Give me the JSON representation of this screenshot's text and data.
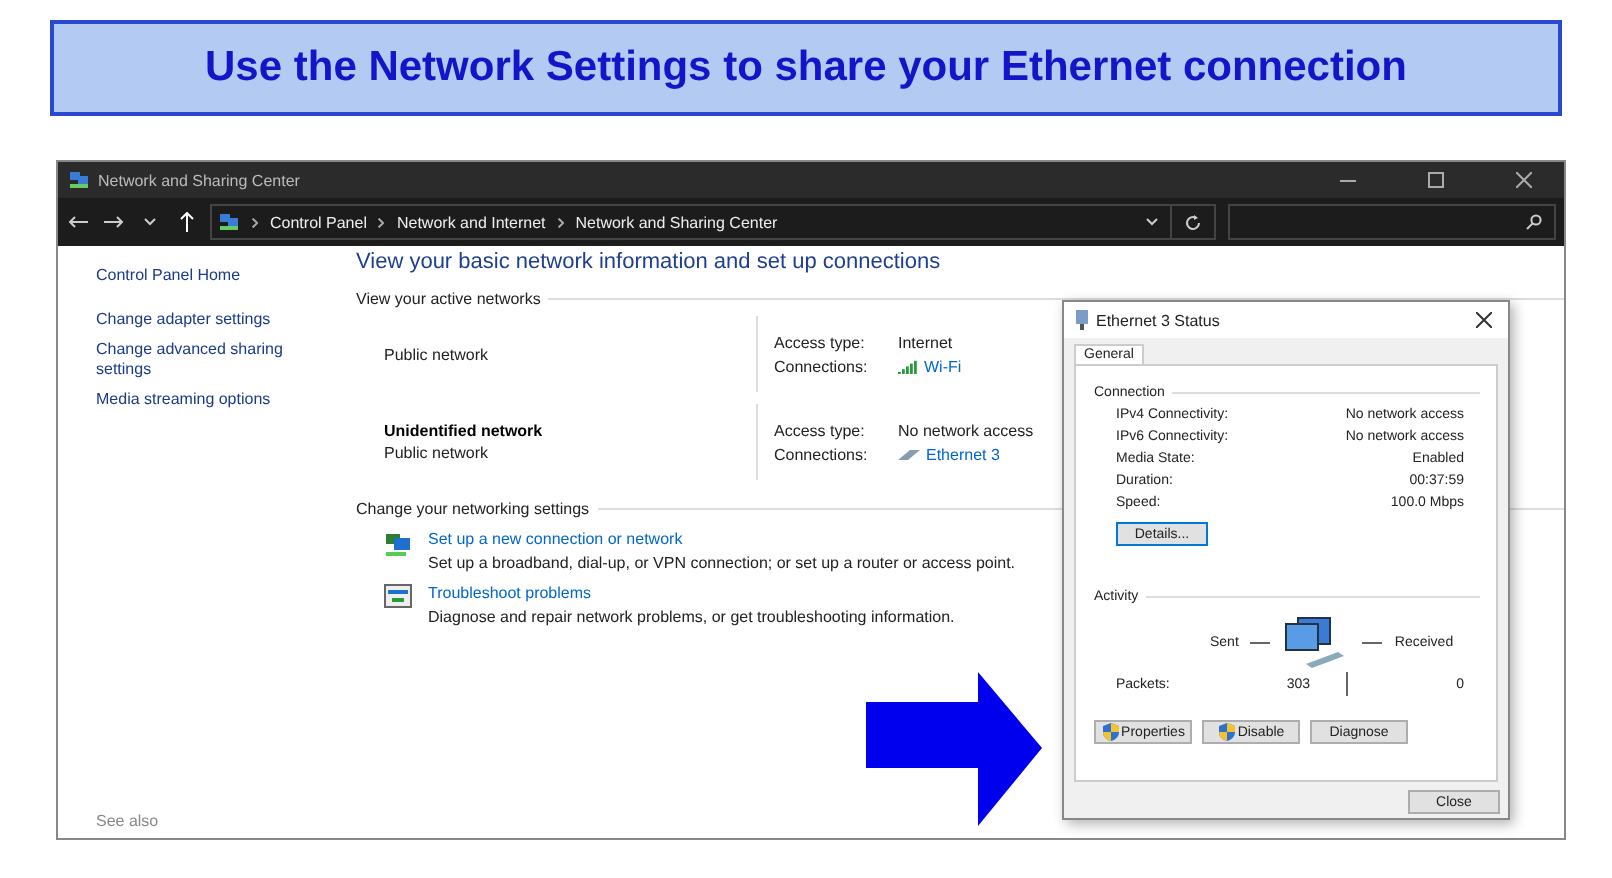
{
  "banner": {
    "title": "Use the Network Settings to share your Ethernet connection"
  },
  "window": {
    "title": "Network and Sharing Center",
    "path": [
      "Control Panel",
      "Network and Internet",
      "Network and Sharing Center"
    ]
  },
  "sidebar": {
    "items": [
      "Control Panel Home",
      "Change adapter settings",
      "Change advanced sharing settings",
      "Media streaming options"
    ],
    "see_also": "See also"
  },
  "main": {
    "heading": "View your basic network information and set up connections",
    "active_label": "View your active networks",
    "networks": [
      {
        "category": "Public network",
        "access_label": "Access type:",
        "access": "Internet",
        "connections_label": "Connections:",
        "connection": "Wi-Fi",
        "kind": "wifi"
      },
      {
        "name": "Unidentified network",
        "category": "Public network",
        "access_label": "Access type:",
        "access": "No network access",
        "connections_label": "Connections:",
        "connection": "Ethernet 3",
        "kind": "ethernet"
      }
    ],
    "settings_label": "Change your networking settings",
    "tasks": [
      {
        "link": "Set up a new connection or network",
        "description": "Set up a broadband, dial-up, or VPN connection; or set up a router or access point.",
        "kind": "setup"
      },
      {
        "link": "Troubleshoot problems",
        "description": "Diagnose and repair network problems, or get troubleshooting information.",
        "kind": "troubleshoot"
      }
    ]
  },
  "dialog": {
    "title": "Ethernet 3 Status",
    "tabs": [
      {
        "label": "General",
        "selected": true
      }
    ],
    "connection_label": "Connection",
    "rows": [
      {
        "label": "IPv4 Connectivity:",
        "value": "No network access"
      },
      {
        "label": "IPv6 Connectivity:",
        "value": "No network access"
      },
      {
        "label": "Media State:",
        "value": "Enabled"
      },
      {
        "label": "Duration:",
        "value": "00:37:59"
      },
      {
        "label": "Speed:",
        "value": "100.0 Mbps"
      }
    ],
    "details_button": "Details...",
    "activity_label": "Activity",
    "sent_label": "Sent",
    "received_label": "Received",
    "packets_label": "Packets:",
    "packets_sent": "303",
    "packets_received": "0",
    "buttons": [
      {
        "label": "Properties",
        "shield": true
      },
      {
        "label": "Disable",
        "shield": true
      },
      {
        "label": "Diagnose",
        "shield": false
      }
    ],
    "close_button": "Close"
  }
}
